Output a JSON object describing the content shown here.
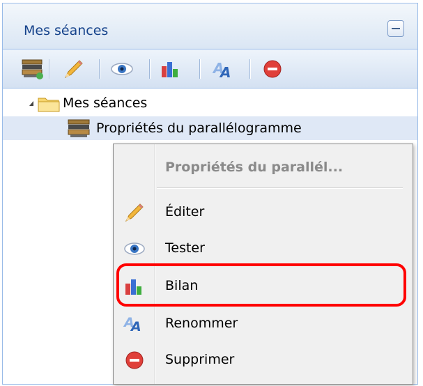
{
  "panel": {
    "title": "Mes séances"
  },
  "toolbar": {
    "buttons": [
      {
        "icon": "session-icon",
        "tooltip": ""
      },
      {
        "icon": "pencil-icon",
        "tooltip": ""
      },
      {
        "icon": "eye-icon",
        "tooltip": ""
      },
      {
        "icon": "bar-chart-icon",
        "tooltip": ""
      },
      {
        "icon": "rename-icon",
        "tooltip": ""
      },
      {
        "icon": "delete-icon",
        "tooltip": ""
      }
    ]
  },
  "tree": {
    "root_label": "Mes séances",
    "child_label": "Propriétés du parallélogramme"
  },
  "context_menu": {
    "header": "Propriétés du parallél...",
    "items": [
      {
        "label": "Éditer",
        "icon": "pencil-icon"
      },
      {
        "label": "Tester",
        "icon": "eye-icon"
      },
      {
        "label": "Bilan",
        "icon": "bar-chart-icon"
      },
      {
        "label": "Renommer",
        "icon": "rename-icon"
      },
      {
        "label": "Supprimer",
        "icon": "delete-icon"
      }
    ]
  },
  "colors": {
    "highlight": "#ff0000",
    "selection": "#dfe8f6",
    "panel_border": "#99bbe8"
  }
}
